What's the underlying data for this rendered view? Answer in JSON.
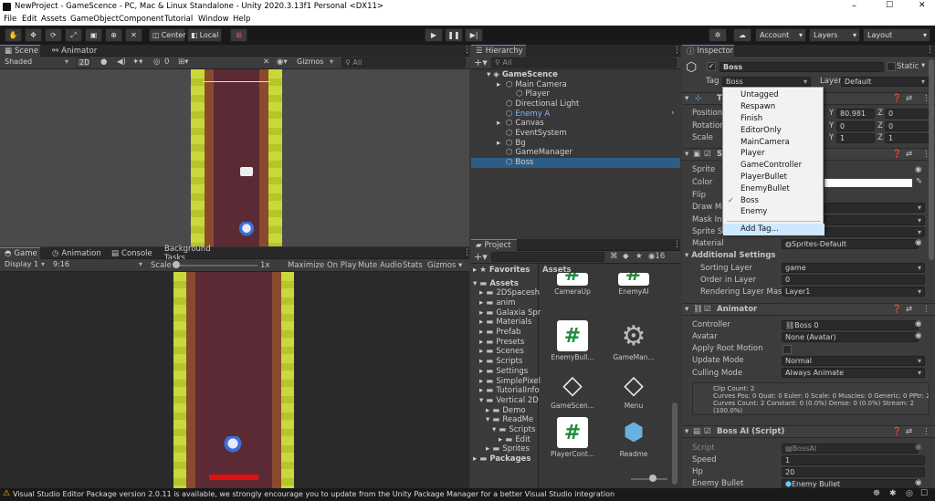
{
  "window": {
    "title": "NewProject - GameScence - PC, Mac & Linux Standalone - Unity 2020.3.13f1 Personal <DX11>",
    "minimize": "–",
    "maximize": "☐",
    "close": "✕"
  },
  "menubar": [
    "File",
    "Edit",
    "Assets",
    "GameObject",
    "Component",
    "Tutorial",
    "Window",
    "Help"
  ],
  "toolbar": {
    "center_label": "Center",
    "local_label": "Local",
    "account_label": "Account",
    "layers_label": "Layers",
    "layout_label": "Layout"
  },
  "scene": {
    "tabs": [
      "Scene",
      "Animator"
    ],
    "shading": "Shaded",
    "mode_2d": "2D",
    "gizmos_label": "Gizmos",
    "search_all": "All",
    "layer_count": "0"
  },
  "game": {
    "tabs": [
      "Game",
      "Animation",
      "Console",
      "Background Tasks"
    ],
    "display": "Display 1",
    "aspect": "9:16",
    "scale_label": "Scale",
    "scale_value": "1x",
    "maximize_on_play": "Maximize On Play",
    "mute_audio": "Mute Audio",
    "stats": "Stats",
    "gizmos": "Gizmos",
    "boss_hp_fraction": 1.0
  },
  "hierarchy": {
    "tab": "Hierarchy",
    "search": "All",
    "scene_name": "GameScence",
    "items": [
      {
        "label": "Main Camera",
        "depth": 1,
        "expandable": true,
        "highlight": false,
        "prefab": false
      },
      {
        "label": "Player",
        "depth": 2,
        "expandable": false,
        "highlight": false,
        "prefab": false
      },
      {
        "label": "Directional Light",
        "depth": 1,
        "expandable": false,
        "highlight": false,
        "prefab": false
      },
      {
        "label": "Enemy A",
        "depth": 1,
        "expandable": false,
        "highlight": false,
        "prefab": true
      },
      {
        "label": "Canvas",
        "depth": 1,
        "expandable": true,
        "highlight": false,
        "prefab": false
      },
      {
        "label": "EventSystem",
        "depth": 1,
        "expandable": false,
        "highlight": false,
        "prefab": false
      },
      {
        "label": "Bg",
        "depth": 1,
        "expandable": true,
        "highlight": false,
        "prefab": false
      },
      {
        "label": "GameManager",
        "depth": 1,
        "expandable": false,
        "highlight": false,
        "prefab": false
      },
      {
        "label": "Boss",
        "depth": 1,
        "expandable": false,
        "highlight": true,
        "prefab": false
      }
    ]
  },
  "project": {
    "tab": "Project",
    "favorites": "Favorites",
    "assets_header": "Assets",
    "count": "16",
    "tree": [
      {
        "label": "Assets",
        "depth": 0,
        "bold": true,
        "open": true
      },
      {
        "label": "2DSpacesh",
        "depth": 1,
        "open": false
      },
      {
        "label": "anim",
        "depth": 1,
        "open": false
      },
      {
        "label": "Galaxia Spr",
        "depth": 1,
        "open": false
      },
      {
        "label": "Materials",
        "depth": 1,
        "open": false
      },
      {
        "label": "Prefab",
        "depth": 1,
        "open": false
      },
      {
        "label": "Presets",
        "depth": 1,
        "open": false
      },
      {
        "label": "Scenes",
        "depth": 1,
        "open": false
      },
      {
        "label": "Scripts",
        "depth": 1,
        "open": false
      },
      {
        "label": "Settings",
        "depth": 1,
        "open": false
      },
      {
        "label": "SimplePixel",
        "depth": 1,
        "open": false
      },
      {
        "label": "TutorialInfo",
        "depth": 1,
        "open": false
      },
      {
        "label": "Vertical 2D",
        "depth": 1,
        "open": true
      },
      {
        "label": "Demo",
        "depth": 2,
        "open": false
      },
      {
        "label": "ReadMe",
        "depth": 2,
        "open": true
      },
      {
        "label": "Scripts",
        "depth": 3,
        "open": true
      },
      {
        "label": "Edit",
        "depth": 4,
        "open": false
      },
      {
        "label": "Sprites",
        "depth": 2,
        "open": false
      },
      {
        "label": "Packages",
        "depth": 0,
        "bold": true,
        "open": false
      }
    ],
    "tiles": [
      {
        "label": "CameraUp",
        "icon": "script-hash-icon"
      },
      {
        "label": "EnemyAI",
        "icon": "script-hash-icon"
      },
      {
        "label": "EnemyBull...",
        "icon": "script-hash-icon"
      },
      {
        "label": "GameMan...",
        "icon": "gear-icon"
      },
      {
        "label": "GameScen...",
        "icon": "unity-scene-icon"
      },
      {
        "label": "Menu",
        "icon": "unity-scene-icon"
      },
      {
        "label": "PlayerCont...",
        "icon": "script-hash-icon"
      },
      {
        "label": "Readme",
        "icon": "readme-box-icon"
      }
    ]
  },
  "inspector": {
    "tab": "Inspector",
    "object_name": "Boss",
    "static_label": "Static",
    "tag_label": "Tag",
    "tag_value": "Boss",
    "layer_label": "Layer",
    "layer_value": "Default",
    "transform": {
      "title": "T",
      "position": "Position",
      "rotation": "Rotation",
      "scale": "Scale",
      "pos_y": "80.981",
      "pos_z": "0",
      "rot_y": "0",
      "rot_z": "0",
      "scale_y": "1",
      "scale_z": "1"
    },
    "sprite_renderer": {
      "title": "S",
      "sprite": "Sprite",
      "color": "Color",
      "flip": "Flip",
      "draw_mode": "Draw Mo",
      "mask_interaction": "Mask Int",
      "sprite_sort": "Sprite So",
      "material_label": "Material",
      "material_value": "Sprites-Default",
      "additional_settings": "Additional Settings",
      "sorting_layer_label": "Sorting Layer",
      "sorting_layer_value": "game",
      "order_label": "Order in Layer",
      "order_value": "0",
      "rendering_mask_label": "Rendering Layer Mask",
      "rendering_mask_value": "Layer1"
    },
    "animator": {
      "title": "Animator",
      "controller_label": "Controller",
      "controller_value": "Boss 0",
      "avatar_label": "Avatar",
      "avatar_value": "None (Avatar)",
      "root_motion_label": "Apply Root Motion",
      "update_mode_label": "Update Mode",
      "update_mode_value": "Normal",
      "culling_label": "Culling Mode",
      "culling_value": "Always Animate",
      "info_line1": "Clip Count: 2",
      "info_line2": "Curves Pos: 0 Quat: 0 Euler: 0 Scale: 0 Muscles: 0 Generic: 0 PPtr: 2",
      "info_line3": "Curves Count: 2 Constant: 0 (0.0%) Dense: 0 (0.0%) Stream: 2",
      "info_line4": "(100.0%)"
    },
    "boss_ai": {
      "title": "Boss AI (Script)",
      "script_label": "Script",
      "script_value": "BossAI",
      "speed_label": "Speed",
      "speed_value": "1",
      "hp_label": "Hp",
      "hp_value": "20",
      "enemy_bullet_label": "Enemy Bullet",
      "enemy_bullet_value": "Enemy Bullet"
    }
  },
  "tag_dropdown": {
    "items": [
      "Untagged",
      "Respawn",
      "Finish",
      "EditorOnly",
      "MainCamera",
      "Player",
      "GameController",
      "PlayerBullet",
      "EnemyBullet",
      "Boss",
      "Enemy"
    ],
    "checked": "Boss",
    "add_tag": "Add Tag..."
  },
  "statusbar": {
    "message": "Visual Studio Editor Package version 2.0.11 is available, we strongly encourage you to update from the Unity Package Manager for a better Visual Studio integration"
  },
  "colors": {
    "accent": "#2c5d87",
    "selection_blue": "#4a8fd8",
    "dropdown_highlight": "#cde8ff",
    "grass": "#c9d93a",
    "road": "#5c2a34",
    "boss_bar": "#e01010",
    "warning": "#f5c518"
  }
}
